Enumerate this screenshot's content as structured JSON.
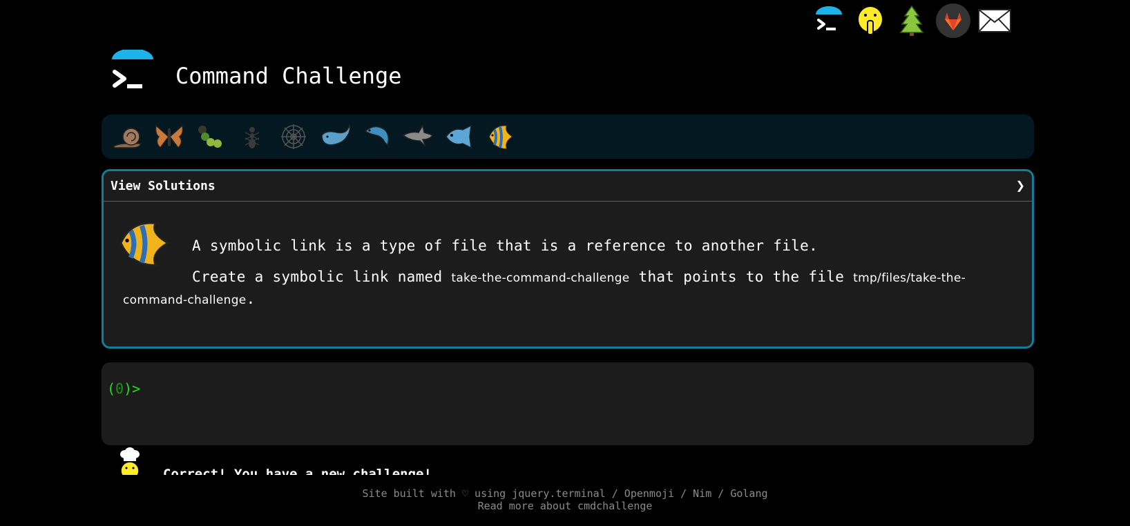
{
  "app": {
    "title": "Command Challenge"
  },
  "topnav": [
    {
      "name": "logo-icon"
    },
    {
      "name": "shushing-face-icon"
    },
    {
      "name": "tree-icon"
    },
    {
      "name": "gitlab-icon"
    },
    {
      "name": "envelope-icon"
    }
  ],
  "levels": [
    {
      "name": "snail-icon",
      "color": "#8b6a4e"
    },
    {
      "name": "butterfly-icon",
      "color": "#c87a3a"
    },
    {
      "name": "caterpillar-icon",
      "color": "#8fb83d"
    },
    {
      "name": "ant-icon",
      "color": "#3a3a3a"
    },
    {
      "name": "spider-web-icon",
      "color": "#555555"
    },
    {
      "name": "whale-icon",
      "color": "#5aa0c8"
    },
    {
      "name": "dolphin-icon",
      "color": "#3f8ec0"
    },
    {
      "name": "shark-icon",
      "color": "#8a8a8a"
    },
    {
      "name": "fish-icon",
      "color": "#5ca6d6"
    },
    {
      "name": "tropical-fish-icon",
      "color": "#f1b31c"
    }
  ],
  "solutions": {
    "title": "View Solutions",
    "chevron": "❯"
  },
  "challenge": {
    "intro": "A symbolic link is a type of file that is a reference to another file.",
    "task_prefix": "Create a symbolic link named ",
    "task_link_name": "take-the-command-challenge",
    "task_middle": " that points to the file ",
    "task_target": "tmp/files/take-the-command-challenge",
    "task_suffix": "."
  },
  "terminal": {
    "prompt_open": "(",
    "prompt_count": "0",
    "prompt_close": ")>"
  },
  "message": {
    "text": "Correct! You have a new challenge!"
  },
  "footer": {
    "line1": "Site built with ♡ using jquery.terminal / Openmoji / Nim / Golang",
    "line2": "Read more about cmdchallenge"
  },
  "colors": {
    "accent": "#0f7f9a",
    "prompt": "#22dd22",
    "levelbar_bg": "#031820",
    "panel_bg": "#1c1c1c"
  }
}
